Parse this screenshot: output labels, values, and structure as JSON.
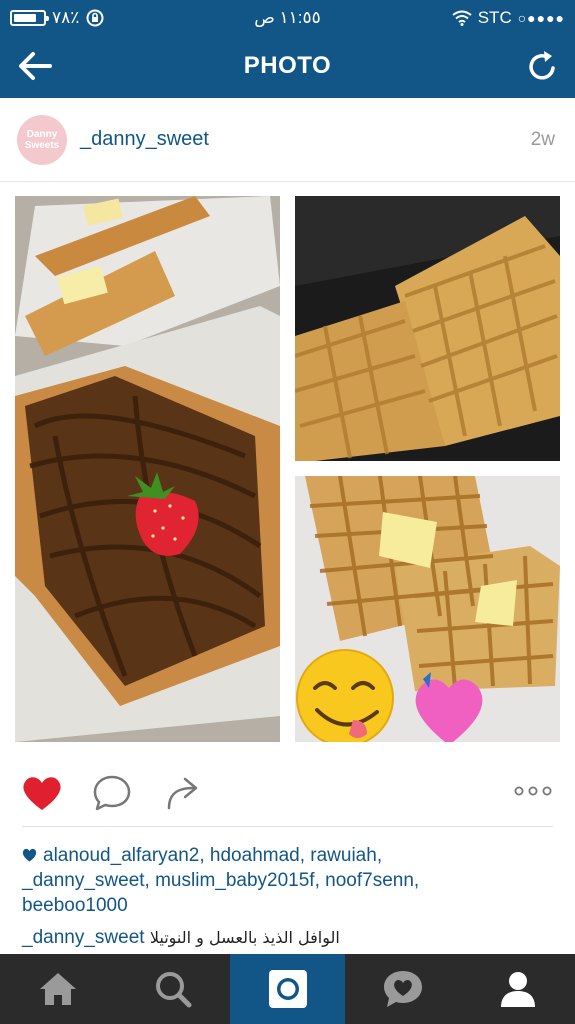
{
  "status_bar": {
    "battery_text": "٧٨٪",
    "battery_level": 0.78,
    "time": "١١:٥٥ ص",
    "carrier": "STC",
    "signal_dots": "○●●●●"
  },
  "header": {
    "title": "PHOTO",
    "back_icon": "arrow-left-icon",
    "refresh_icon": "refresh-icon"
  },
  "post": {
    "username": "_danny_sweet",
    "avatar_text_top": "Danny",
    "avatar_text_bottom": "Sweets",
    "age": "2w",
    "liked_by": [
      "alanoud_alfaryan2",
      "hdoahmad",
      "rawuiah",
      "_danny_sweet",
      "muslim_baby2015f",
      "noof7senn",
      "beeboo1000"
    ],
    "caption_user": "_danny_sweet",
    "caption_text": "الوافل الذيذ بالعسل و النوتيلا"
  },
  "actions": {
    "like_icon": "heart-icon",
    "comment_icon": "comment-icon",
    "share_icon": "share-icon",
    "more_icon": "more-icon",
    "like_color": "#e0202f"
  },
  "bottom_nav": {
    "items": [
      "home-icon",
      "search-icon",
      "camera-icon",
      "activity-icon",
      "profile-icon"
    ],
    "active_index": 2
  },
  "colors": {
    "brand": "#125688",
    "link": "#125688",
    "nav_bg": "#2b2b2b"
  }
}
